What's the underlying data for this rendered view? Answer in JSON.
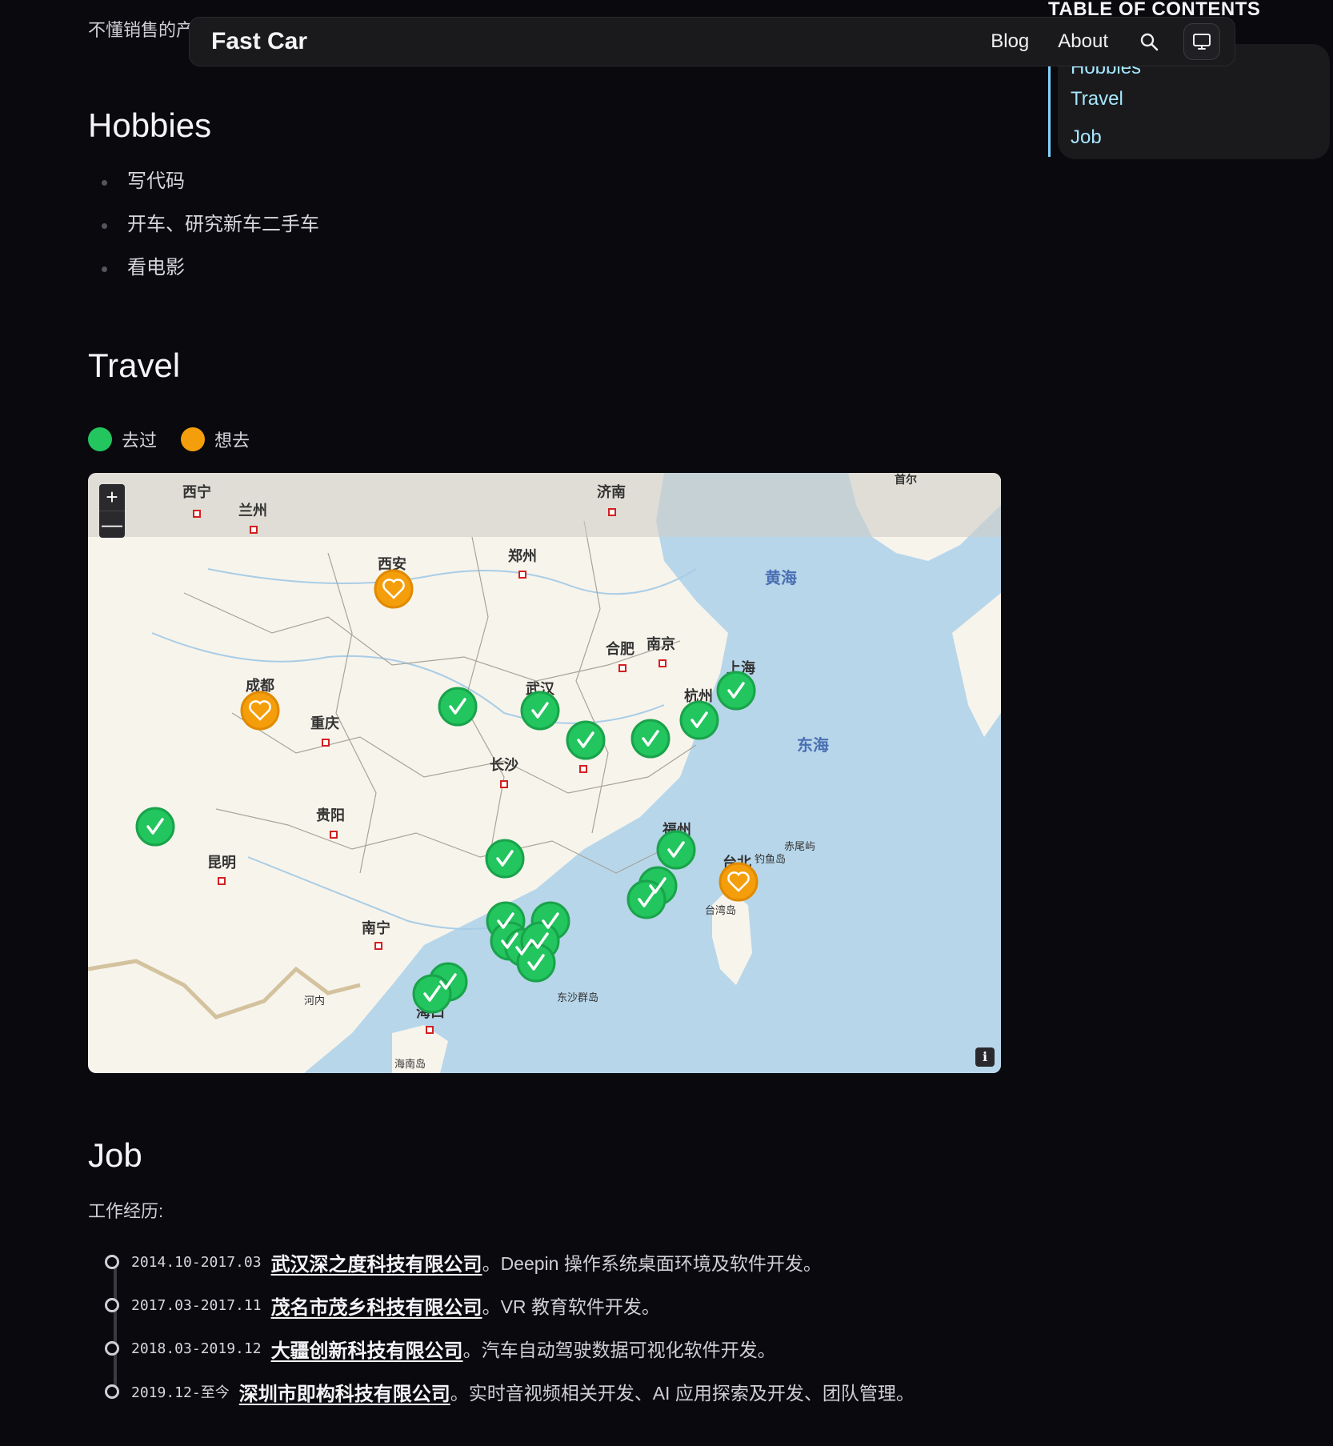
{
  "intro": {
    "clipped_text": "不懂销售的产"
  },
  "header": {
    "brand": "Fast Car",
    "nav": [
      "Blog",
      "About"
    ],
    "search_icon": "search-icon",
    "theme_icon": "monitor-icon"
  },
  "toc": {
    "title": "TABLE OF CONTENTS",
    "items": [
      "Hobbies",
      "Travel",
      "Job"
    ],
    "accent": "#7dd3fc"
  },
  "hobbies": {
    "title": "Hobbies",
    "items": [
      "写代码",
      "开车、研究新车二手车",
      "看电影"
    ]
  },
  "travel": {
    "title": "Travel",
    "legend": [
      {
        "label": "去过",
        "color": "#22c55e"
      },
      {
        "label": "想去",
        "color": "#f59e0b"
      }
    ],
    "map": {
      "zoom_in": "+",
      "zoom_out": "—",
      "info": "i",
      "cities": [
        "西宁",
        "兰州",
        "济南",
        "郑州",
        "西安",
        "合肥",
        "南京",
        "上海",
        "杭州",
        "武汉",
        "成都",
        "重庆",
        "长沙",
        "贵阳",
        "昆明",
        "福州",
        "台北",
        "南宁",
        "海口",
        "首尔"
      ],
      "seas": [
        "黄海",
        "东海"
      ],
      "islands": [
        "台湾岛",
        "钓鱼岛",
        "赤尾屿",
        "东沙群岛",
        "海南岛",
        "河内"
      ]
    }
  },
  "job": {
    "title": "Job",
    "intro": "工作经历:",
    "items": [
      {
        "date": "2014.10-2017.03",
        "company": "武汉深之度科技有限公司",
        "desc": "。Deepin 操作系统桌面环境及软件开发。"
      },
      {
        "date": "2017.03-2017.11",
        "company": "茂名市茂乡科技有限公司",
        "desc": "。VR 教育软件开发。"
      },
      {
        "date": "2018.03-2019.12",
        "company": "大疆创新科技有限公司",
        "desc": "。汽车自动驾驶数据可视化软件开发。"
      },
      {
        "date": "2019.12-至今",
        "company": "深圳市即构科技有限公司",
        "desc": "。实时音视频相关开发、AI 应用探索及开发、团队管理。"
      }
    ]
  }
}
